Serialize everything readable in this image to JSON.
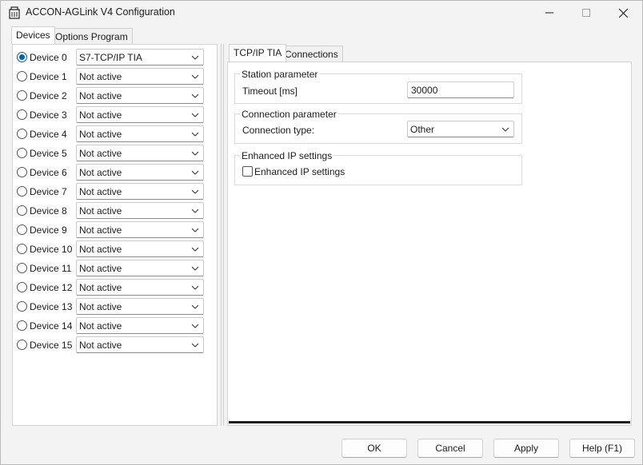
{
  "window": {
    "title": "ACCON-AGLink V4 Configuration",
    "icons": {
      "app": "app-icon",
      "minimize": "minimize-icon",
      "maximize": "maximize-icon",
      "close": "close-icon"
    }
  },
  "outer_tabs": [
    {
      "label": "Devices",
      "active": true
    },
    {
      "label": "Options Program",
      "active": false
    }
  ],
  "devices": [
    {
      "label": "Device 0",
      "value": "S7-TCP/IP TIA",
      "selected": true
    },
    {
      "label": "Device 1",
      "value": "Not active",
      "selected": false
    },
    {
      "label": "Device 2",
      "value": "Not active",
      "selected": false
    },
    {
      "label": "Device 3",
      "value": "Not active",
      "selected": false
    },
    {
      "label": "Device 4",
      "value": "Not active",
      "selected": false
    },
    {
      "label": "Device 5",
      "value": "Not active",
      "selected": false
    },
    {
      "label": "Device 6",
      "value": "Not active",
      "selected": false
    },
    {
      "label": "Device 7",
      "value": "Not active",
      "selected": false
    },
    {
      "label": "Device 8",
      "value": "Not active",
      "selected": false
    },
    {
      "label": "Device 9",
      "value": "Not active",
      "selected": false
    },
    {
      "label": "Device 10",
      "value": "Not active",
      "selected": false
    },
    {
      "label": "Device 11",
      "value": "Not active",
      "selected": false
    },
    {
      "label": "Device 12",
      "value": "Not active",
      "selected": false
    },
    {
      "label": "Device 13",
      "value": "Not active",
      "selected": false
    },
    {
      "label": "Device 14",
      "value": "Not active",
      "selected": false
    },
    {
      "label": "Device 15",
      "value": "Not active",
      "selected": false
    }
  ],
  "inner_tabs": [
    {
      "label": "TCP/IP TIA",
      "active": true
    },
    {
      "label": "Connections",
      "active": false
    }
  ],
  "station": {
    "title": "Station parameter",
    "timeout_label": "Timeout [ms]",
    "timeout_value": "30000"
  },
  "connection": {
    "title": "Connection parameter",
    "type_label": "Connection type:",
    "type_value": "Other"
  },
  "enhanced": {
    "title": "Enhanced IP settings",
    "checkbox_label": "Enhanced IP settings",
    "checked": false
  },
  "buttons": {
    "ok": "OK",
    "cancel": "Cancel",
    "apply": "Apply",
    "help": "Help (F1)"
  },
  "colors": {
    "accent": "#005fb8",
    "window_bg": "#f3f3f3",
    "panel_bg": "#ffffff"
  }
}
